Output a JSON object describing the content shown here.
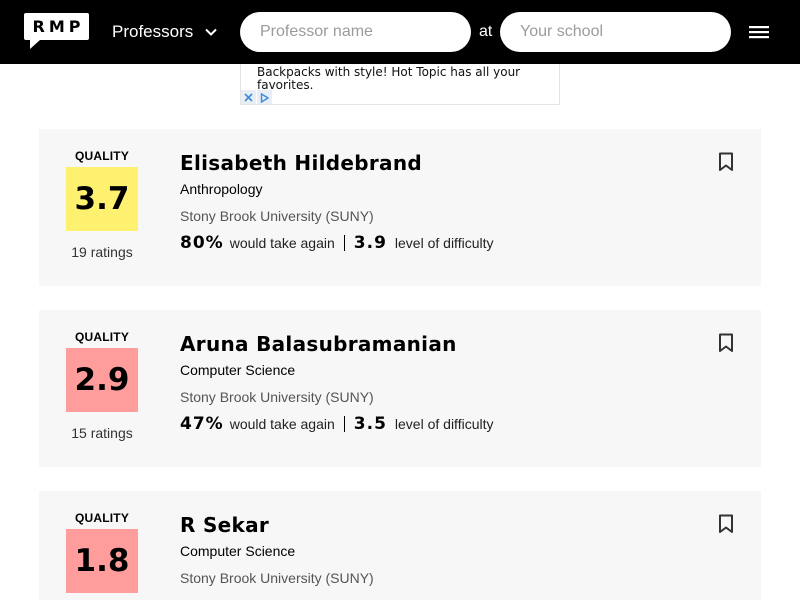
{
  "header": {
    "logo": "RMP",
    "search_type": "Professors",
    "prof_placeholder": "Professor name",
    "at_label": "at",
    "school_placeholder": "Your school"
  },
  "ad": {
    "text": "Backpacks with style! Hot Topic has all your favorites."
  },
  "colors": {
    "header_bg": "#000000",
    "card_bg": "#f7f7f7",
    "score_high": "#fff170",
    "score_low": "#ff9c9c"
  },
  "professors": [
    {
      "quality_label": "QUALITY",
      "score": "3.7",
      "score_color": "#fff170",
      "ratings": "19 ratings",
      "name": "Elisabeth Hildebrand",
      "department": "Anthropology",
      "school": "Stony Brook University (SUNY)",
      "take_again": "80%",
      "take_again_label": "would take again",
      "difficulty": "3.9",
      "difficulty_label": "level of difficulty"
    },
    {
      "quality_label": "QUALITY",
      "score": "2.9",
      "score_color": "#ff9c9c",
      "ratings": "15 ratings",
      "name": "Aruna Balasubramanian",
      "department": "Computer Science",
      "school": "Stony Brook University (SUNY)",
      "take_again": "47%",
      "take_again_label": "would take again",
      "difficulty": "3.5",
      "difficulty_label": "level of difficulty"
    },
    {
      "quality_label": "QUALITY",
      "score": "1.8",
      "score_color": "#ff9c9c",
      "ratings": "",
      "name": "R Sekar",
      "department": "Computer Science",
      "school": "Stony Brook University (SUNY)",
      "take_again": "",
      "take_again_label": "",
      "difficulty": "",
      "difficulty_label": ""
    }
  ]
}
